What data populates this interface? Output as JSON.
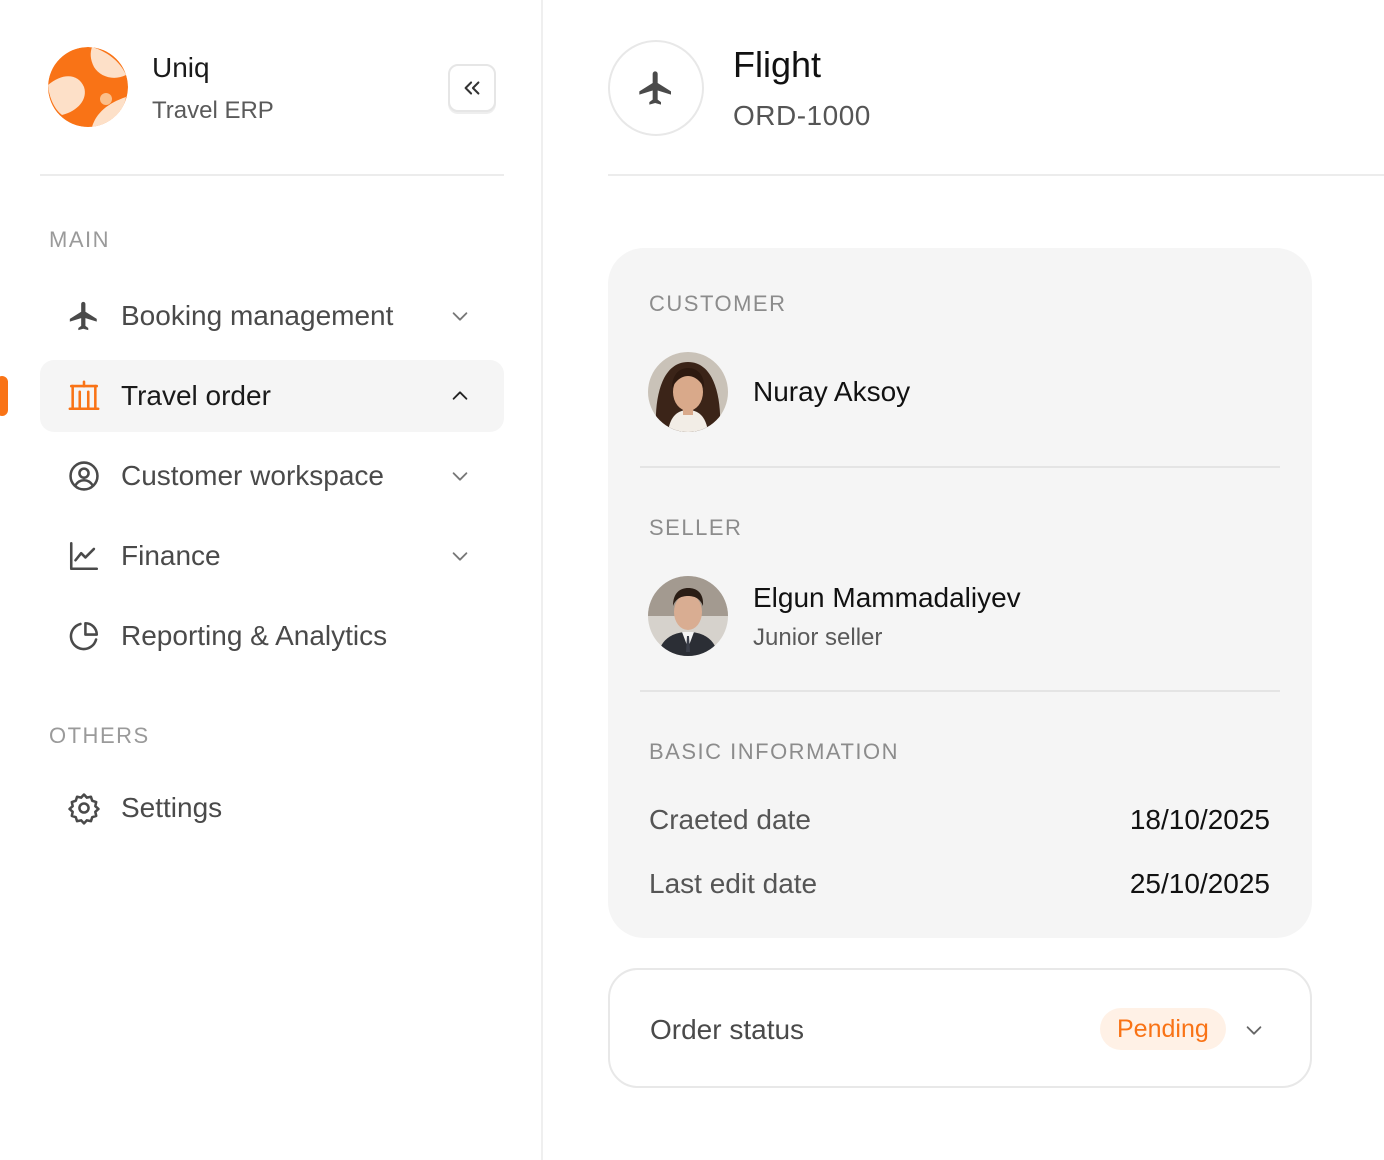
{
  "brand": {
    "name": "Uniq",
    "subtitle": "Travel ERP",
    "accent": "#f97316"
  },
  "sidebar": {
    "collapse_icon": "double-chevron-left-icon",
    "sections": [
      {
        "label": "MAIN",
        "items": [
          {
            "label": "Booking management",
            "icon": "airplane-icon",
            "expandable": true,
            "expanded": false,
            "active": false
          },
          {
            "label": "Travel order",
            "icon": "bank-building-icon",
            "expandable": true,
            "expanded": true,
            "active": true
          },
          {
            "label": "Customer workspace",
            "icon": "user-circle-icon",
            "expandable": true,
            "expanded": false,
            "active": false
          },
          {
            "label": "Finance",
            "icon": "line-chart-icon",
            "expandable": true,
            "expanded": false,
            "active": false
          },
          {
            "label": "Reporting & Analytics",
            "icon": "pie-chart-icon",
            "expandable": false,
            "active": false
          }
        ]
      },
      {
        "label": "OTHERS",
        "items": [
          {
            "label": "Settings",
            "icon": "gear-icon",
            "expandable": false,
            "active": false
          }
        ]
      }
    ]
  },
  "header": {
    "icon": "airplane-icon",
    "title": "Flight",
    "order_id": "ORD-1000"
  },
  "details": {
    "customer": {
      "caption": "CUSTOMER",
      "name": "Nuray Aksoy"
    },
    "seller": {
      "caption": "SELLER",
      "name": "Elgun Mammadaliyev",
      "role": "Junior seller"
    },
    "basic_info": {
      "caption": "BASIC INFORMATION",
      "rows": [
        {
          "label": "Craeted date",
          "value": "18/10/2025"
        },
        {
          "label": "Last edit date",
          "value": "25/10/2025"
        }
      ]
    }
  },
  "order_status": {
    "label": "Order status",
    "value": "Pending",
    "badge_color": "#f97316",
    "badge_bg": "#fff1e6"
  }
}
